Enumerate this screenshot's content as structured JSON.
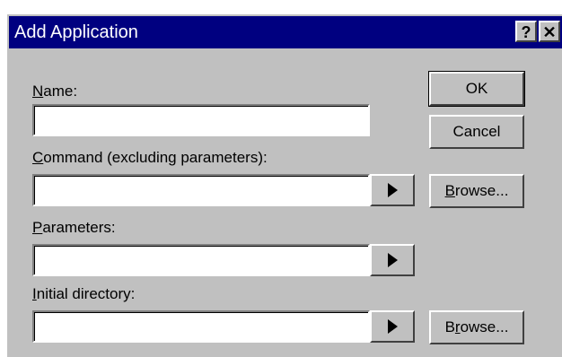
{
  "dialog": {
    "title": "Add Application",
    "help_glyph": "?",
    "close_glyph": "✕"
  },
  "fields": {
    "name": {
      "label_hotkey": "N",
      "label_rest": "ame:",
      "value": ""
    },
    "command": {
      "label_hotkey": "C",
      "label_rest": "ommand (excluding parameters):",
      "value": ""
    },
    "parameters": {
      "label_hotkey": "P",
      "label_rest": "arameters:",
      "value": ""
    },
    "initial_directory": {
      "label_hotkey": "I",
      "label_rest": "nitial directory:",
      "value": ""
    }
  },
  "buttons": {
    "ok": "OK",
    "cancel": "Cancel",
    "browse1_hotkey": "B",
    "browse1_rest": "rowse...",
    "browse2_pre": "B",
    "browse2_hotkey": "r",
    "browse2_rest": "owse..."
  },
  "icons": {
    "arrow": "right-triangle-arrow-icon"
  }
}
